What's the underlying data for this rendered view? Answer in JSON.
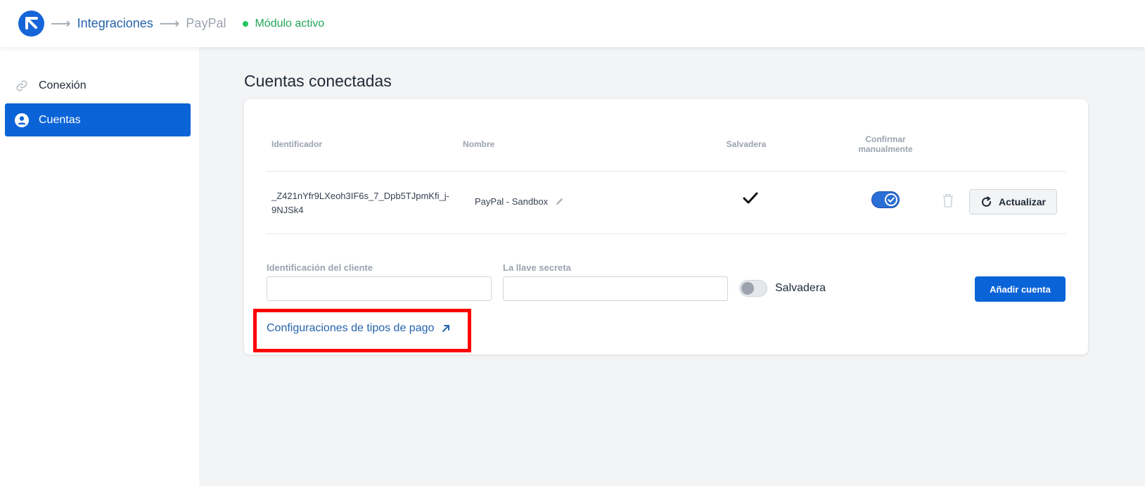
{
  "header": {
    "breadcrumb": [
      "Integraciones",
      "PayPal"
    ],
    "status": "Módulo activo",
    "accent_color": "#1565d8",
    "status_color": "#22a55a",
    "logo_icon": "arrow-up-left-logo"
  },
  "sidebar": {
    "items": [
      {
        "label": "Conexión",
        "icon": "link-icon",
        "active": false
      },
      {
        "label": "Cuentas",
        "icon": "user-circle-icon",
        "active": true
      }
    ]
  },
  "main": {
    "title": "Cuentas conectadas",
    "table": {
      "headers": {
        "id": "Identificador",
        "name": "Nombre",
        "sandbox": "Salvadera",
        "confirm": "Confirmar manualmente"
      },
      "rows": [
        {
          "id": "_Z421nYfr9LXeoh3IF6s_7_Dpb5TJpmKfi_j-9NJSk4",
          "name": "PayPal - Sandbox",
          "sandbox": true,
          "confirm_manually": true,
          "update_label": "Actualizar"
        }
      ]
    },
    "form": {
      "client_id_label": "Identificación del cliente",
      "client_id_value": "",
      "secret_label": "La llave secreta",
      "secret_value": "",
      "sandbox_label": "Salvadera",
      "sandbox_on": false,
      "add_label": "Añadir cuenta"
    },
    "config_link": "Configuraciones de tipos de pago",
    "highlight_color": "#ff0000"
  }
}
